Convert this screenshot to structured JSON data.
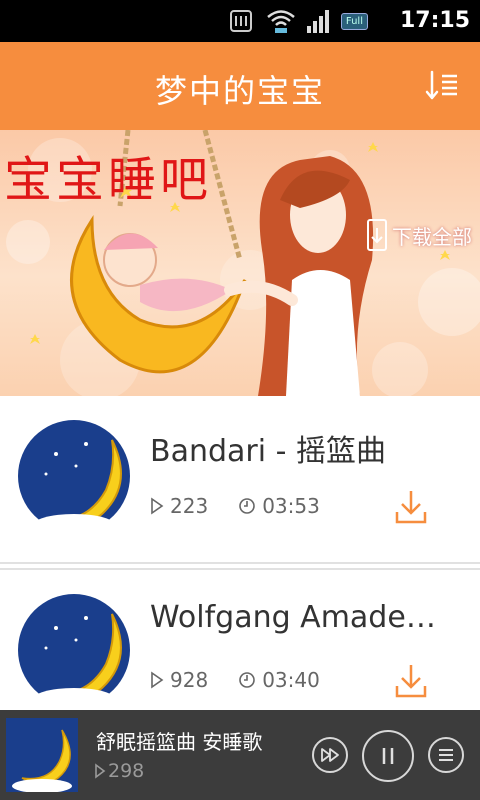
{
  "status_bar": {
    "time": "17:15",
    "battery_label": "Full",
    "icons": [
      "sd-card-icon",
      "wifi-icon",
      "signal-icon",
      "battery-icon"
    ]
  },
  "header": {
    "title": "梦中的宝宝",
    "sort_icon": "sort-icon"
  },
  "banner": {
    "title": "宝宝睡吧",
    "download_all": "下载全部"
  },
  "tracks": [
    {
      "title": "Bandari - 摇篮曲",
      "plays": "223",
      "duration": "03:53"
    },
    {
      "title": "Wolfgang Amadeus ...",
      "plays": "928",
      "duration": "03:40"
    }
  ],
  "player": {
    "title": "舒眠摇篮曲 安睡歌",
    "plays": "298"
  },
  "colors": {
    "accent": "#f68d3e",
    "player_bg": "#3c3c3c",
    "banner_text": "#e01616"
  }
}
